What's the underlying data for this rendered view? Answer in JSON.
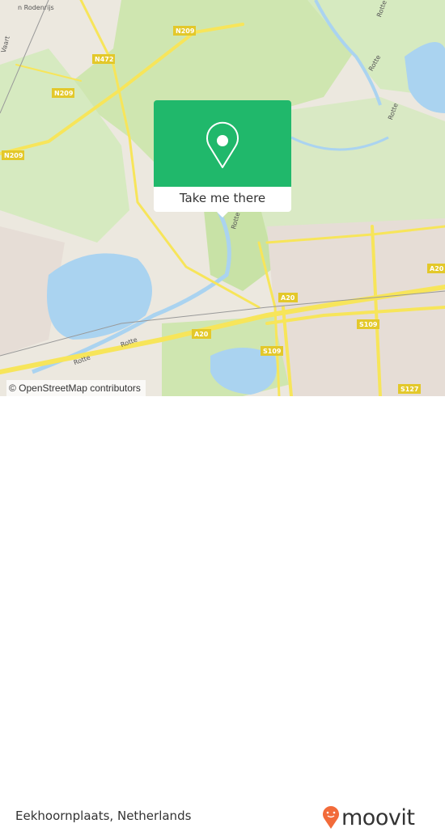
{
  "map": {
    "labels": {
      "town": "n Rodenrijs",
      "vaart": "Vaart",
      "rotte1": "Rotte",
      "rotte2": "Rotte",
      "rotte3": "Rotte",
      "rotte4": "Rotte",
      "rotte5": "Rotte"
    },
    "shields": {
      "n209a": "N209",
      "n472": "N472",
      "n209b": "N209",
      "n209c": "N209",
      "a20a": "A20",
      "a20b": "A20",
      "a20c": "A20",
      "s109a": "S109",
      "s109b": "S109",
      "s127": "S127"
    },
    "colors": {
      "land": "#ece8df",
      "green": "#cfe6b0",
      "water": "#aad3f0",
      "road": "#f7e55a",
      "popup": "#20b86b"
    },
    "attribution": "© OpenStreetMap contributors"
  },
  "popup": {
    "icon": "map-pin-icon",
    "button_label": "Take me there"
  },
  "footer": {
    "place_name": "Eekhoornplaats, Netherlands",
    "logo_text": "moovit",
    "logo_color": "#f26b3a"
  }
}
